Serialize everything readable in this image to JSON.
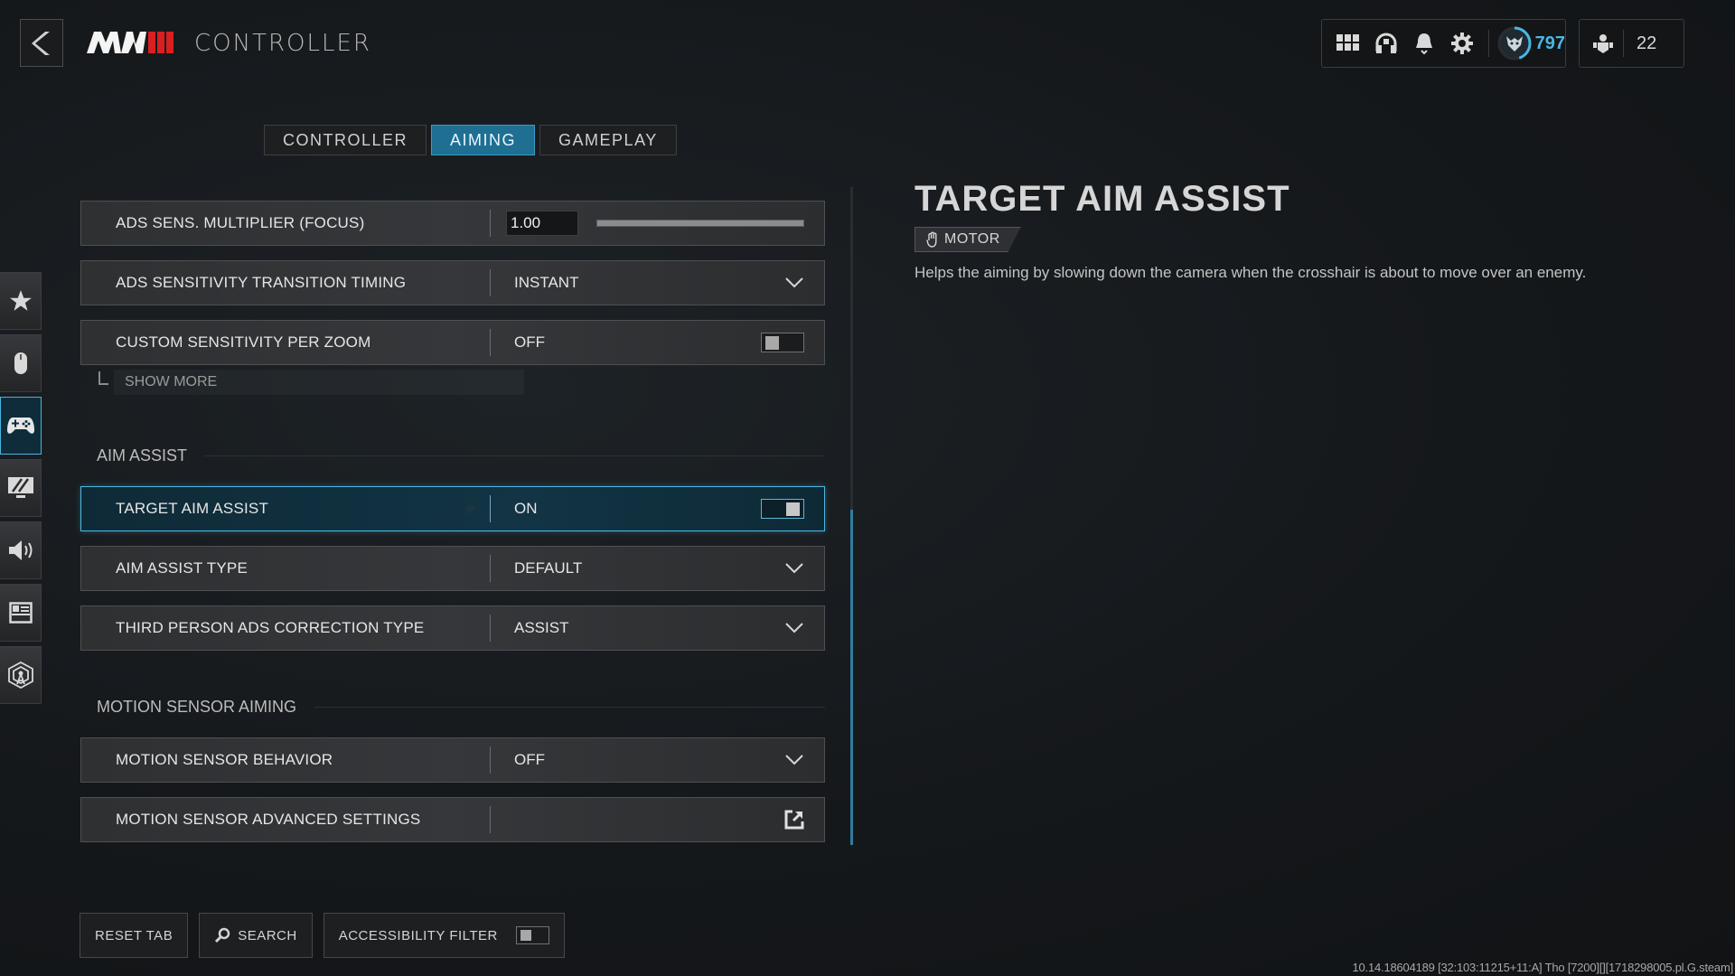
{
  "header": {
    "back_icon": "chevron-left-icon",
    "logo_text": "MW",
    "logo_numeral": "III",
    "title": "CONTROLLER"
  },
  "topbar": {
    "icons": [
      "grid-icon",
      "headset-icon",
      "bell-icon",
      "gear-icon"
    ],
    "rank_value": "797",
    "rank_progress_fraction": 0.45,
    "friends_icon": "friends-icon",
    "friends_count": "22"
  },
  "tabs": [
    {
      "label": "CONTROLLER",
      "active": false
    },
    {
      "label": "AIMING",
      "active": true
    },
    {
      "label": "GAMEPLAY",
      "active": false
    }
  ],
  "sidenav": [
    {
      "icon": "star-icon",
      "active": false
    },
    {
      "icon": "mouse-icon",
      "active": false
    },
    {
      "icon": "gamepad-icon",
      "active": true
    },
    {
      "icon": "display-icon",
      "active": false
    },
    {
      "icon": "speaker-icon",
      "active": false
    },
    {
      "icon": "interface-icon",
      "active": false
    },
    {
      "icon": "network-icon",
      "active": false
    }
  ],
  "settings": {
    "rows": [
      {
        "label": "ADS SENS. MULTIPLIER (FOCUS)",
        "value": "1.00",
        "control": "slider",
        "slider_fraction": 1.0
      },
      {
        "label": "ADS SENSITIVITY TRANSITION TIMING",
        "value": "INSTANT",
        "control": "dropdown"
      },
      {
        "label": "CUSTOM SENSITIVITY PER ZOOM",
        "value": "OFF",
        "control": "toggle",
        "on": false
      }
    ],
    "show_more_label": "SHOW MORE",
    "sections": [
      {
        "title": "AIM ASSIST",
        "rows": [
          {
            "label": "TARGET AIM ASSIST",
            "value": "ON",
            "control": "toggle",
            "on": true,
            "selected": true
          },
          {
            "label": "AIM ASSIST TYPE",
            "value": "DEFAULT",
            "control": "dropdown"
          },
          {
            "label": "THIRD PERSON ADS CORRECTION TYPE",
            "value": "ASSIST",
            "control": "dropdown"
          }
        ]
      },
      {
        "title": "MOTION SENSOR AIMING",
        "rows": [
          {
            "label": "MOTION SENSOR BEHAVIOR",
            "value": "OFF",
            "control": "dropdown"
          },
          {
            "label": "MOTION SENSOR ADVANCED SETTINGS",
            "value": "",
            "control": "external-link"
          }
        ]
      }
    ]
  },
  "scrollbar": {
    "thumb_start_fraction": 0.49,
    "thumb_end_fraction": 1.0
  },
  "detail": {
    "title": "TARGET AIM ASSIST",
    "tag_icon": "hand-icon",
    "tag_label": "MOTOR",
    "description": "Helps the aiming by slowing down the camera when the crosshair is about to move over an enemy."
  },
  "bottom_bar": {
    "reset_label": "RESET TAB",
    "search_label": "SEARCH",
    "accessibility_label": "ACCESSIBILITY FILTER",
    "accessibility_on": false
  },
  "build_info": "10.14.18604189 [32:103:11215+11:A] Tho [7200][][1718298005.pl.G.steam]",
  "colors": {
    "accent": "#4fb8e2",
    "tab_active": "#1f6f93",
    "rank": "#4ab6e4",
    "logo_red": "#d91f1f"
  }
}
